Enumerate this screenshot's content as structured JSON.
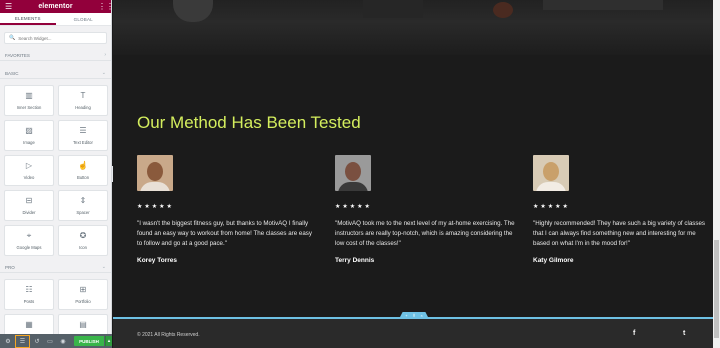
{
  "app": {
    "logo": "elementor",
    "menu_icon": "hamburger-icon",
    "widgets_icon": "grid-icon"
  },
  "tabs": [
    {
      "label": "ELEMENTS"
    },
    {
      "label": "GLOBAL"
    }
  ],
  "search": {
    "placeholder": "Search Widget..."
  },
  "sections": {
    "favorites": "FAVORITES",
    "basic": "BASIC",
    "pro": "PRO"
  },
  "basic_widgets": [
    {
      "label": "Inner Section",
      "icon": "columns-icon"
    },
    {
      "label": "Heading",
      "icon": "heading-icon"
    },
    {
      "label": "Image",
      "icon": "image-icon"
    },
    {
      "label": "Text Editor",
      "icon": "text-editor-icon"
    },
    {
      "label": "Video",
      "icon": "video-icon"
    },
    {
      "label": "Button",
      "icon": "button-icon"
    },
    {
      "label": "Divider",
      "icon": "divider-icon"
    },
    {
      "label": "Spacer",
      "icon": "spacer-icon"
    },
    {
      "label": "Google Maps",
      "icon": "map-icon"
    },
    {
      "label": "Icon",
      "icon": "star-icon"
    }
  ],
  "pro_widgets": [
    {
      "label": "Posts",
      "icon": "posts-icon"
    },
    {
      "label": "Portfolio",
      "icon": "portfolio-icon"
    },
    {
      "label": "Gallery",
      "icon": "gallery-icon"
    },
    {
      "label": "Form",
      "icon": "form-icon"
    }
  ],
  "bottom_bar": {
    "publish": "PUBLISH"
  },
  "page": {
    "title": "Our Method Has Been Tested",
    "testimonials": [
      {
        "stars": "★★★★★",
        "quote": "\"I wasn't the biggest fitness guy, but thanks to MotivAQ I finally found an easy way to workout from home! The classes are easy to follow and go at a good pace.\"",
        "name": "Korey Torres"
      },
      {
        "stars": "★★★★★",
        "quote": "\"MotivAQ took me to the next level of my at-home exercising. The instructors are really top-notch, which is amazing considering the low cost of the classes!\"",
        "name": "Terry Dennis"
      },
      {
        "stars": "★★★★★",
        "quote": "\"Highly recommended! They have such a big variety of classes that I can always find something new and interesting for me based on what I'm in the mood for!\"",
        "name": "Katy Gilmore"
      }
    ],
    "footer": {
      "copyright": "© 2021 All Rights Reserved.",
      "social": [
        "facebook-icon",
        "twitter-icon"
      ]
    }
  },
  "colors": {
    "brand": "#92003b",
    "accent": "#d4ee5e",
    "publish": "#39b54a",
    "edit_outline": "#6ec1e4"
  }
}
